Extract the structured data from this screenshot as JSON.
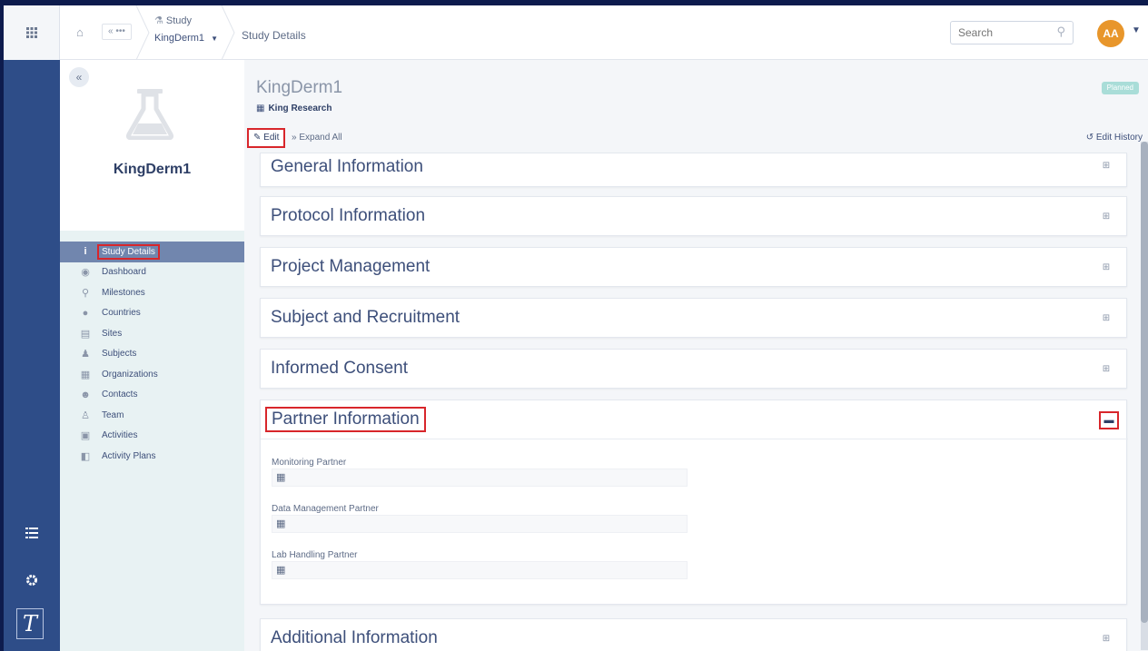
{
  "rail": {
    "apps_icon": "grid-icon",
    "list_icon": "list-icon",
    "settings_icon": "gear-icon",
    "logo_text": "T"
  },
  "topbar": {
    "home_icon": "home-icon",
    "crumb_more": "« •••",
    "study_label": "Study",
    "study_name": "KingDerm1",
    "current_page": "Study Details",
    "search_placeholder": "Search",
    "avatar_initials": "AA"
  },
  "panel": {
    "collapse_label": "«",
    "title": "KingDerm1",
    "nav": [
      {
        "label": "Study Details",
        "icon": "i",
        "active": true
      },
      {
        "label": "Dashboard",
        "icon": "◉"
      },
      {
        "label": "Milestones",
        "icon": "⚲"
      },
      {
        "label": "Countries",
        "icon": "●"
      },
      {
        "label": "Sites",
        "icon": "▤"
      },
      {
        "label": "Subjects",
        "icon": "♟"
      },
      {
        "label": "Organizations",
        "icon": "▦"
      },
      {
        "label": "Contacts",
        "icon": "☻"
      },
      {
        "label": "Team",
        "icon": "♙"
      },
      {
        "label": "Activities",
        "icon": "▣"
      },
      {
        "label": "Activity Plans",
        "icon": "◧"
      }
    ]
  },
  "main": {
    "study_name": "KingDerm1",
    "organization": "King Research",
    "status": "Planned",
    "edit_label": "Edit",
    "expand_all_label": "Expand All",
    "edit_history_label": "Edit History",
    "sections": [
      {
        "title": "General Information"
      },
      {
        "title": "Protocol Information"
      },
      {
        "title": "Project Management"
      },
      {
        "title": "Subject and Recruitment"
      },
      {
        "title": "Informed Consent"
      },
      {
        "title": "Partner Information",
        "open": true
      },
      {
        "title": "Additional Information"
      }
    ],
    "partner_fields": [
      {
        "label": "Monitoring Partner",
        "value": ""
      },
      {
        "label": "Data Management Partner",
        "value": ""
      },
      {
        "label": "Lab Handling Partner",
        "value": ""
      }
    ]
  },
  "colors": {
    "rail": "#2e4d88",
    "accent_red": "#d8262b",
    "avatar": "#e8962b",
    "status_badge": "#a9ddd8",
    "nav_active": "#7186ae"
  }
}
